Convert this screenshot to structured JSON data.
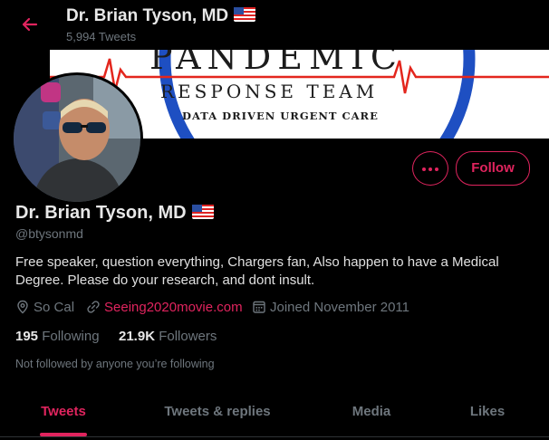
{
  "header": {
    "name": "Dr. Brian Tyson, MD",
    "tweet_count": "5,994 Tweets",
    "back_icon": "arrow-left-icon",
    "flag_icon": "us-flag-icon"
  },
  "banner": {
    "title": "PANDEMIC",
    "subtitle": "RESPONSE TEAM",
    "tagline": "DATA DRIVEN URGENT CARE"
  },
  "actions": {
    "more_icon": "more-horizontal-icon",
    "follow_label": "Follow"
  },
  "profile": {
    "name": "Dr. Brian Tyson, MD",
    "handle": "@btysonmd",
    "bio": "Free speaker, question everything, Chargers fan, Also happen to have a Medical Degree. Please do your research, and dont insult.",
    "location": "So Cal",
    "website": "Seeing2020movie.com",
    "joined": "Joined November 2011"
  },
  "stats": {
    "following_count": "195",
    "following_label": "Following",
    "followers_count": "21.9K",
    "followers_label": "Followers"
  },
  "followed_note": "Not followed by anyone you’re following",
  "tabs": [
    {
      "label": "Tweets",
      "active": true
    },
    {
      "label": "Tweets & replies",
      "active": false
    },
    {
      "label": "Media",
      "active": false
    },
    {
      "label": "Likes",
      "active": false
    }
  ],
  "colors": {
    "accent": "#e0245e",
    "background": "#000000",
    "muted_text": "#6e767d"
  }
}
